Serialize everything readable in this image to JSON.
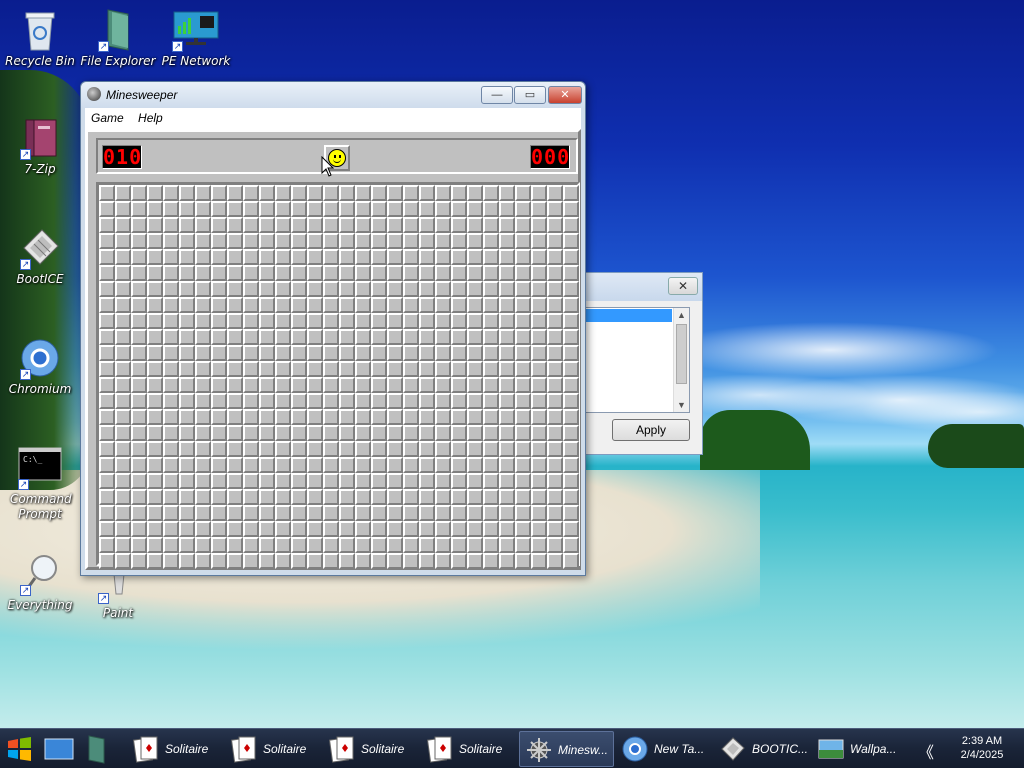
{
  "desktop": {
    "icons": [
      {
        "label": "Recycle Bin"
      },
      {
        "label": "File Explorer"
      },
      {
        "label": "PE Network Manager"
      },
      {
        "label": "7-Zip"
      },
      {
        "label": "BootICE"
      },
      {
        "label": "Chromium"
      },
      {
        "label": "Command Prompt"
      },
      {
        "label": "Everything"
      },
      {
        "label": "Paint"
      }
    ]
  },
  "minesweeper": {
    "title": "Minesweeper",
    "menu": [
      "Game",
      "Help"
    ],
    "mine_counter": "010",
    "timer": "000",
    "rows": 24,
    "cols": 30,
    "caption_buttons": {
      "minimize": "—",
      "maximize": "▭",
      "close": "✕"
    }
  },
  "background_dialog": {
    "close": "✕",
    "apply_label": "Apply"
  },
  "taskbar": {
    "tasks": [
      {
        "label": "Solitaire",
        "icon": "cards-icon",
        "active": false
      },
      {
        "label": "Solitaire",
        "icon": "cards-icon",
        "active": false
      },
      {
        "label": "Solitaire",
        "icon": "cards-icon",
        "active": false
      },
      {
        "label": "Solitaire",
        "icon": "cards-icon",
        "active": false
      },
      {
        "label": "Minesw...",
        "icon": "mine-icon",
        "active": true
      },
      {
        "label": "New Ta...",
        "icon": "chromium-icon",
        "active": false
      },
      {
        "label": "BOOTIC...",
        "icon": "bootice-icon",
        "active": false
      },
      {
        "label": "Wallpa...",
        "icon": "wallpaper-icon",
        "active": false
      }
    ],
    "tray_chevron": "《",
    "clock_time": "2:39 AM",
    "clock_date": "2/4/2025"
  },
  "colors": {
    "led_red": "#ff0000",
    "board_gray": "#c0c0c0",
    "selection_blue": "#3399ff"
  }
}
